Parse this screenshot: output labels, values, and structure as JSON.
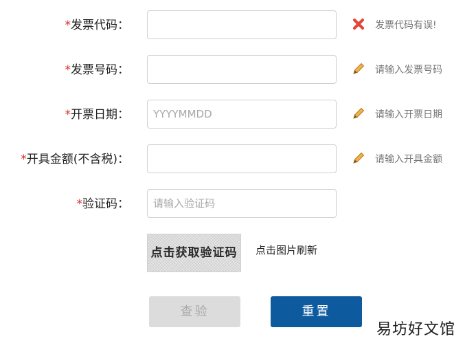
{
  "form": {
    "required_mark": "*",
    "invoice_code": {
      "label": "发票代码：",
      "value": "",
      "placeholder": "",
      "hint": "发票代码有误!",
      "hint_icon": "error-x-icon",
      "hint_color": "#e0463a"
    },
    "invoice_number": {
      "label": "发票号码：",
      "value": "",
      "placeholder": "",
      "hint": "请输入发票号码",
      "hint_icon": "pencil-icon"
    },
    "invoice_date": {
      "label": "开票日期：",
      "value": "",
      "placeholder": "YYYYMMDD",
      "hint": "请输入开票日期",
      "hint_icon": "pencil-icon"
    },
    "amount": {
      "label": "开具金额(不含税)：",
      "value": "",
      "placeholder": "",
      "hint": "请输入开具金额",
      "hint_icon": "pencil-icon"
    },
    "captcha_code": {
      "label": "验证码：",
      "value": "",
      "placeholder": "请输入验证码"
    },
    "captcha_image_text": "点击获取验证码",
    "refresh_text": "点击图片刷新"
  },
  "buttons": {
    "check_label": "查验",
    "reset_label": "重置"
  },
  "colors": {
    "required": "#d9302c",
    "primary": "#0e5a9f",
    "disabled": "#dcdcdc",
    "pencil": "#e8a23a"
  },
  "watermark": "易坊好文馆"
}
